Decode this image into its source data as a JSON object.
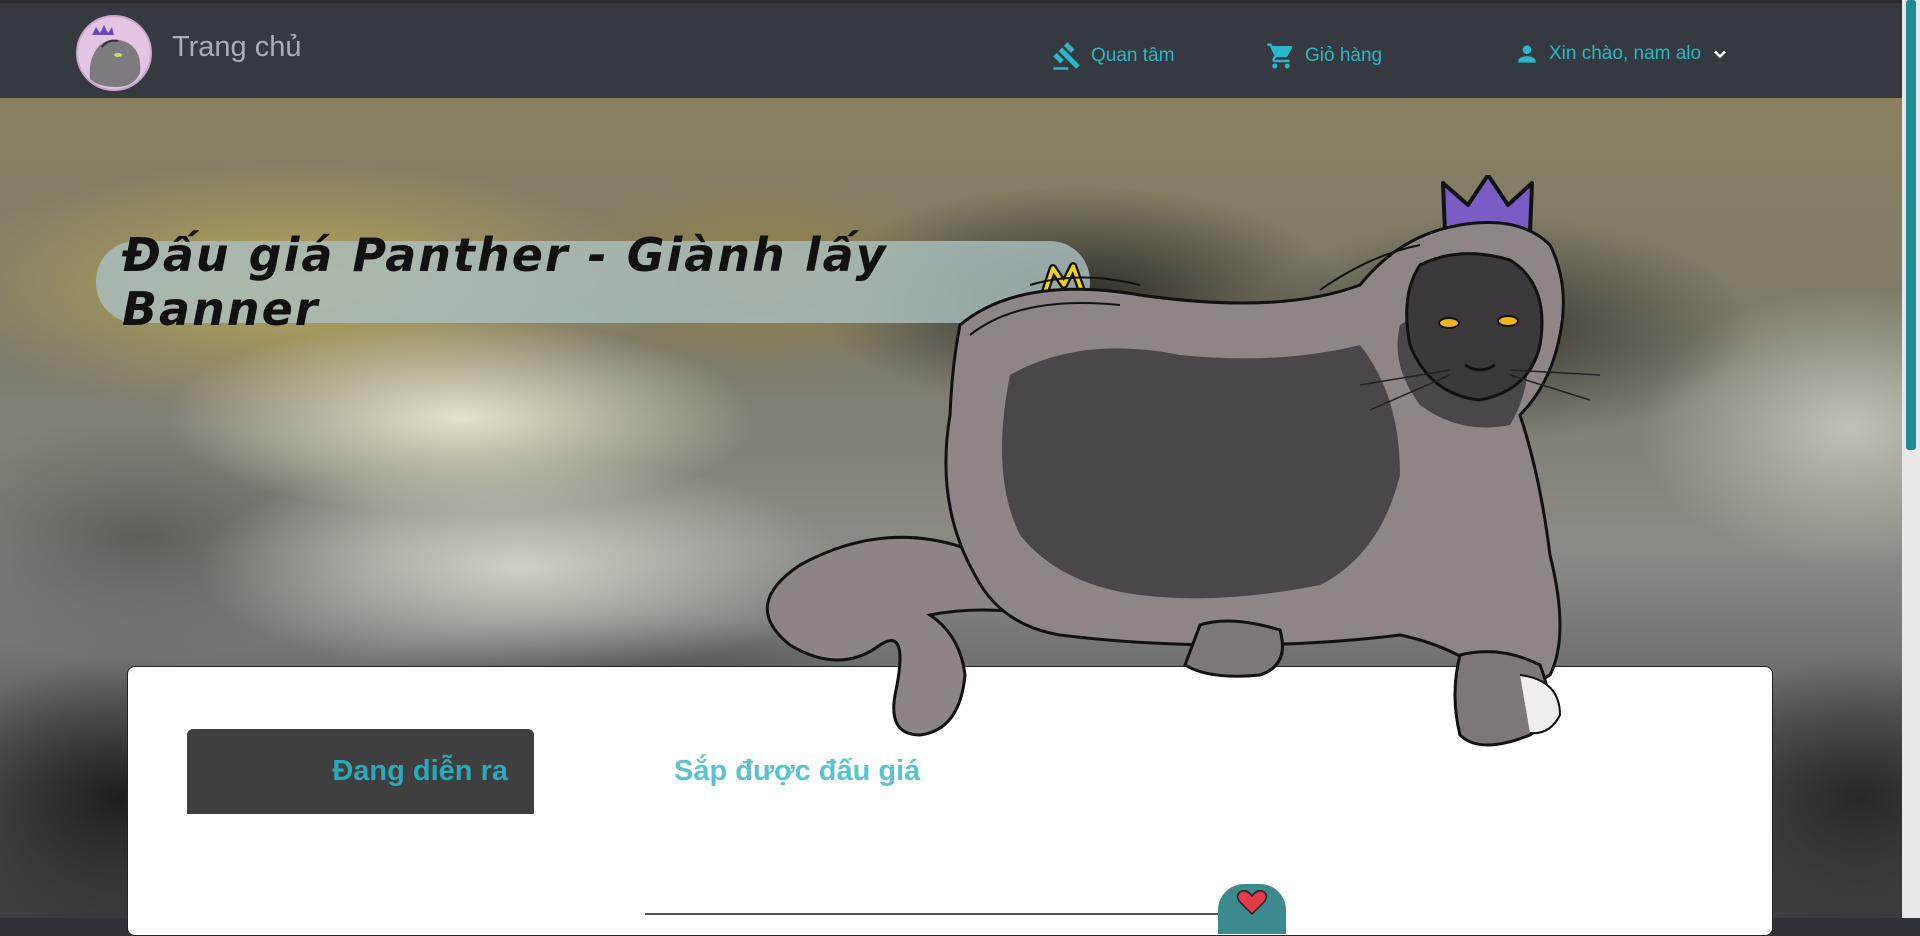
{
  "navbar": {
    "brand": "Trang chủ",
    "items": [
      {
        "label": "Quan tâm",
        "icon": "gavel-icon"
      },
      {
        "label": "Giỏ hàng",
        "icon": "cart-icon"
      },
      {
        "label": "Xin chào, nam alo",
        "icon": "user-icon"
      }
    ]
  },
  "banner": {
    "title": "Đấu giá Panther - Giành lấy Banner"
  },
  "tabs": [
    {
      "label": "Đang diễn ra",
      "active": true
    },
    {
      "label": "Sắp được đấu giá",
      "active": false
    }
  ],
  "colors": {
    "navbar": "#343a40",
    "accent": "#2bb7c8",
    "tab_active_bg": "#3f3f3f",
    "crown": "#7b5cc4",
    "heart": "#e23b4a"
  }
}
